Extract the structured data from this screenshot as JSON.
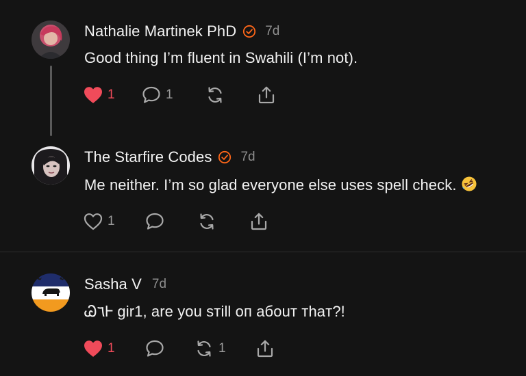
{
  "comments": [
    {
      "author": "Nathalie Martinek PhD",
      "verified": true,
      "time": "7d",
      "text": "Good thing I’m fluent in Swahili (I’m not).",
      "liked": true,
      "likes": "1",
      "replies": "1",
      "restacks": "",
      "icons": [
        "heart-filled-icon",
        "reply-icon",
        "restack-icon",
        "share-icon"
      ]
    },
    {
      "author": "The Starfire Codes",
      "verified": true,
      "time": "7d",
      "text": "Me neither. I’m so glad everyone else uses spell check.",
      "emoji": "rolling-on-floor-laughing-emoji",
      "liked": false,
      "likes": "1",
      "replies": "",
      "restacks": "",
      "icons": [
        "heart-outline-icon",
        "reply-icon",
        "restack-icon",
        "share-icon"
      ]
    },
    {
      "author": "Sasha V",
      "verified": false,
      "time": "7d",
      "text": "Ꮚ٦Ꮀ gir1, are you sтill oп aбouт тhaт?!",
      "liked": true,
      "likes": "1",
      "replies": "",
      "restacks": "1",
      "icons": [
        "heart-filled-icon",
        "reply-icon",
        "restack-icon",
        "share-icon"
      ]
    }
  ],
  "colors": {
    "background": "#141414",
    "accent_verified": "#ff6719",
    "like_red": "#f04b5a",
    "muted": "#8e8e8e"
  }
}
